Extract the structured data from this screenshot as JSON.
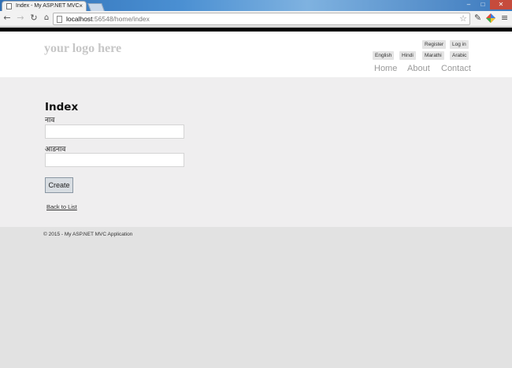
{
  "browser": {
    "tab_title": "Index - My ASP.NET MVC",
    "tab_close": "×",
    "url_host": "localhost",
    "url_rest": ":56548/home/index",
    "window_controls": [
      "–",
      "□",
      "✕"
    ],
    "icons": [
      "back-icon",
      "forward-icon",
      "reload-icon",
      "home-icon",
      "star-icon",
      "extension-icon",
      "menu-icon"
    ]
  },
  "header": {
    "logo": "your logo here",
    "account_links": {
      "register": "Register",
      "login": "Log in"
    },
    "languages": [
      "English",
      "Hindi",
      "Marathi",
      "Arabic"
    ],
    "menu": [
      "Home",
      "About",
      "Contact"
    ]
  },
  "main": {
    "title": "Index",
    "fields": [
      {
        "label": "नाव",
        "value": ""
      },
      {
        "label": "आडनाव",
        "value": ""
      }
    ],
    "create_label": "Create",
    "back_link": "Back to List"
  },
  "footer": {
    "copyright": "© 2015 - My ASP.NET MVC Application"
  },
  "colors": {
    "header_bg": "#ffffff",
    "content_bg": "#efeeef",
    "footer_bg": "#e2e2e2",
    "logo": "#c7c7c7"
  }
}
